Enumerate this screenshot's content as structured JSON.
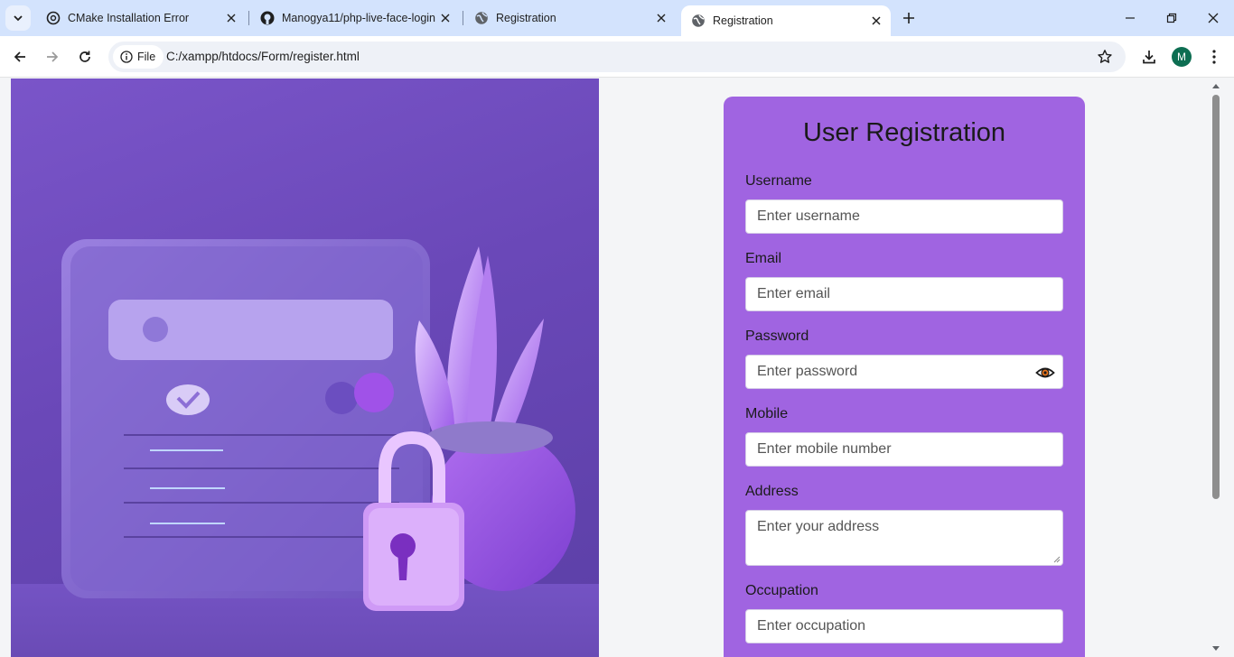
{
  "browser": {
    "tabs": [
      {
        "title": "CMake Installation Error",
        "icon": "openai-icon"
      },
      {
        "title": "Manogya11/php-live-face-login",
        "icon": "github-icon"
      },
      {
        "title": "Registration",
        "icon": "globe-icon"
      },
      {
        "title": "Registration",
        "icon": "globe-icon",
        "active": true
      }
    ],
    "site_chip": "File",
    "url": "C:/xampp/htdocs/Form/register.html",
    "profile_initial": "M"
  },
  "form": {
    "title": "User Registration",
    "fields": [
      {
        "label": "Username",
        "placeholder": "Enter username"
      },
      {
        "label": "Email",
        "placeholder": "Enter email"
      },
      {
        "label": "Password",
        "placeholder": "Enter password"
      },
      {
        "label": "Mobile",
        "placeholder": "Enter mobile number"
      },
      {
        "label": "Address",
        "placeholder": "Enter your address"
      },
      {
        "label": "Occupation",
        "placeholder": "Enter occupation"
      }
    ]
  },
  "colors": {
    "card": "#a064e1",
    "hero": "#6a48b8",
    "tabstrip": "#d3e3fd"
  }
}
